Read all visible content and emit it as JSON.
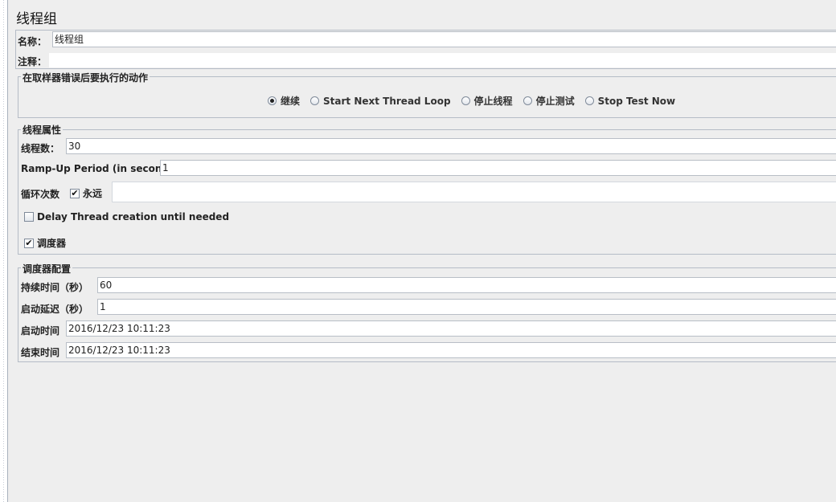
{
  "panel": {
    "title": "线程组",
    "name_label": "名称：",
    "name_value": "线程组",
    "comment_label": "注释：",
    "comment_value": ""
  },
  "sampler_error_action": {
    "title": "在取样器错误后要执行的动作",
    "options": [
      {
        "label": "继续",
        "selected": true
      },
      {
        "label": "Start Next Thread Loop",
        "selected": false
      },
      {
        "label": "停止线程",
        "selected": false
      },
      {
        "label": "停止测试",
        "selected": false
      },
      {
        "label": "Stop Test Now",
        "selected": false
      }
    ]
  },
  "thread_properties": {
    "title": "线程属性",
    "threads_label": "线程数：",
    "threads_value": "30",
    "rampup_label": "Ramp-Up Period (in seconds):",
    "rampup_value": "1",
    "loop_label": "循环次数",
    "forever_label": "永远",
    "forever_checked": true,
    "loop_value": "",
    "delay_label": "Delay Thread creation until needed",
    "delay_checked": false,
    "scheduler_label": "调度器",
    "scheduler_checked": true
  },
  "scheduler_config": {
    "title": "调度器配置",
    "duration_label": "持续时间（秒）",
    "duration_value": "60",
    "delay_label": "启动延迟（秒）",
    "delay_value": "1",
    "start_label": "启动时间",
    "start_value": "2016/12/23 10:11:23",
    "end_label": "结束时间",
    "end_value": "2016/12/23 10:11:23"
  },
  "icons": {
    "check": "✔"
  }
}
